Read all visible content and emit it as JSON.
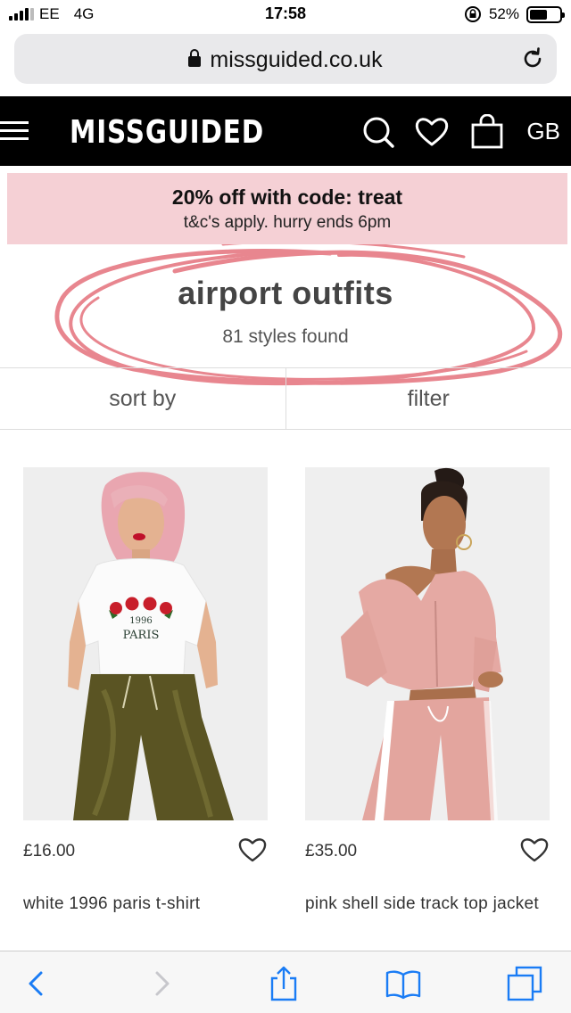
{
  "status_bar": {
    "carrier": "EE",
    "network": "4G",
    "time": "17:58",
    "battery": "52%",
    "battery_level": 0.52,
    "signal_bars": 4
  },
  "browser": {
    "url": "missguided.co.uk",
    "lock_icon": "lock-icon",
    "reload_icon": "reload-icon"
  },
  "header": {
    "logo": "MISSGUIDED",
    "region": "GB",
    "icons": [
      "menu-icon",
      "search-icon",
      "heart-icon",
      "shopping-bag-icon"
    ]
  },
  "promo": {
    "title": "20% off with code: treat",
    "subtitle": "t&c's apply. hurry ends 6pm"
  },
  "listing": {
    "title": "airport outfits",
    "count": "81 styles found",
    "sort_label": "sort by",
    "filter_label": "filter"
  },
  "products": [
    {
      "price": "£16.00",
      "name": "white 1996 paris t-shirt",
      "shirt_print_year": "1996",
      "shirt_print_city": "PARIS"
    },
    {
      "price": "£35.00",
      "name": "pink shell side track top jacket"
    }
  ],
  "toolbar": {
    "icons": [
      "back-icon",
      "forward-icon",
      "share-icon",
      "bookmarks-icon",
      "tabs-icon"
    ]
  },
  "colors": {
    "header_bg": "#000000",
    "promo_bg": "#f5d0d5",
    "scribble": "#e8868f",
    "toolbar_blue": "#1a7cf5"
  }
}
